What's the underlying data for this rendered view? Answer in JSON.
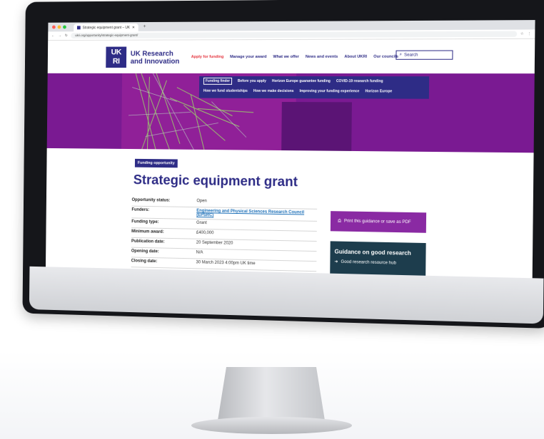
{
  "browser": {
    "tab_title": "Strategic equipment grant – UK",
    "new_tab": "+",
    "url": "ukri.org/opportunity/strategic-equipment-grant/"
  },
  "logo": {
    "mark_line1": "UK",
    "mark_line2": "RI",
    "line1": "UK Research",
    "line2": "and Innovation"
  },
  "main_nav": [
    "Apply for funding",
    "Manage your award",
    "What we offer",
    "News and events",
    "About UKRI",
    "Our councils"
  ],
  "search": {
    "label": "Search"
  },
  "sub_nav": {
    "row1": [
      "Funding finder",
      "Before you apply",
      "Horizon Europe guarantee funding",
      "COVID-19 research funding"
    ],
    "row2": [
      "How we fund studentships",
      "How we make decisions",
      "Improving your funding experience",
      "Horizon Europe"
    ]
  },
  "page": {
    "badge": "Funding opportunity",
    "title": "Strategic equipment grant",
    "details": [
      {
        "label": "Opportunity status:",
        "value": "Open"
      },
      {
        "label": "Funders:",
        "value": "Engineering and Physical Sciences Research Council (EPSRC)"
      },
      {
        "label": "Funding type:",
        "value": "Grant"
      },
      {
        "label": "Minimum award:",
        "value": "£400,000"
      },
      {
        "label": "Publication date:",
        "value": "20 September 2020"
      },
      {
        "label": "Opening date:",
        "value": "N/A"
      },
      {
        "label": "Closing date:",
        "value": "30 March 2023 4:00pm UK time"
      }
    ]
  },
  "sidebar": {
    "print_label": "Print this guidance or save as PDF",
    "guidance_title": "Guidance on good research",
    "guidance_link": "Good research resource hub"
  },
  "colors": {
    "brand_navy": "#2e2c86",
    "hero_purple": "#7a1a92",
    "accent_red": "#e4323c",
    "guidance_bg": "#1d3d4d"
  }
}
